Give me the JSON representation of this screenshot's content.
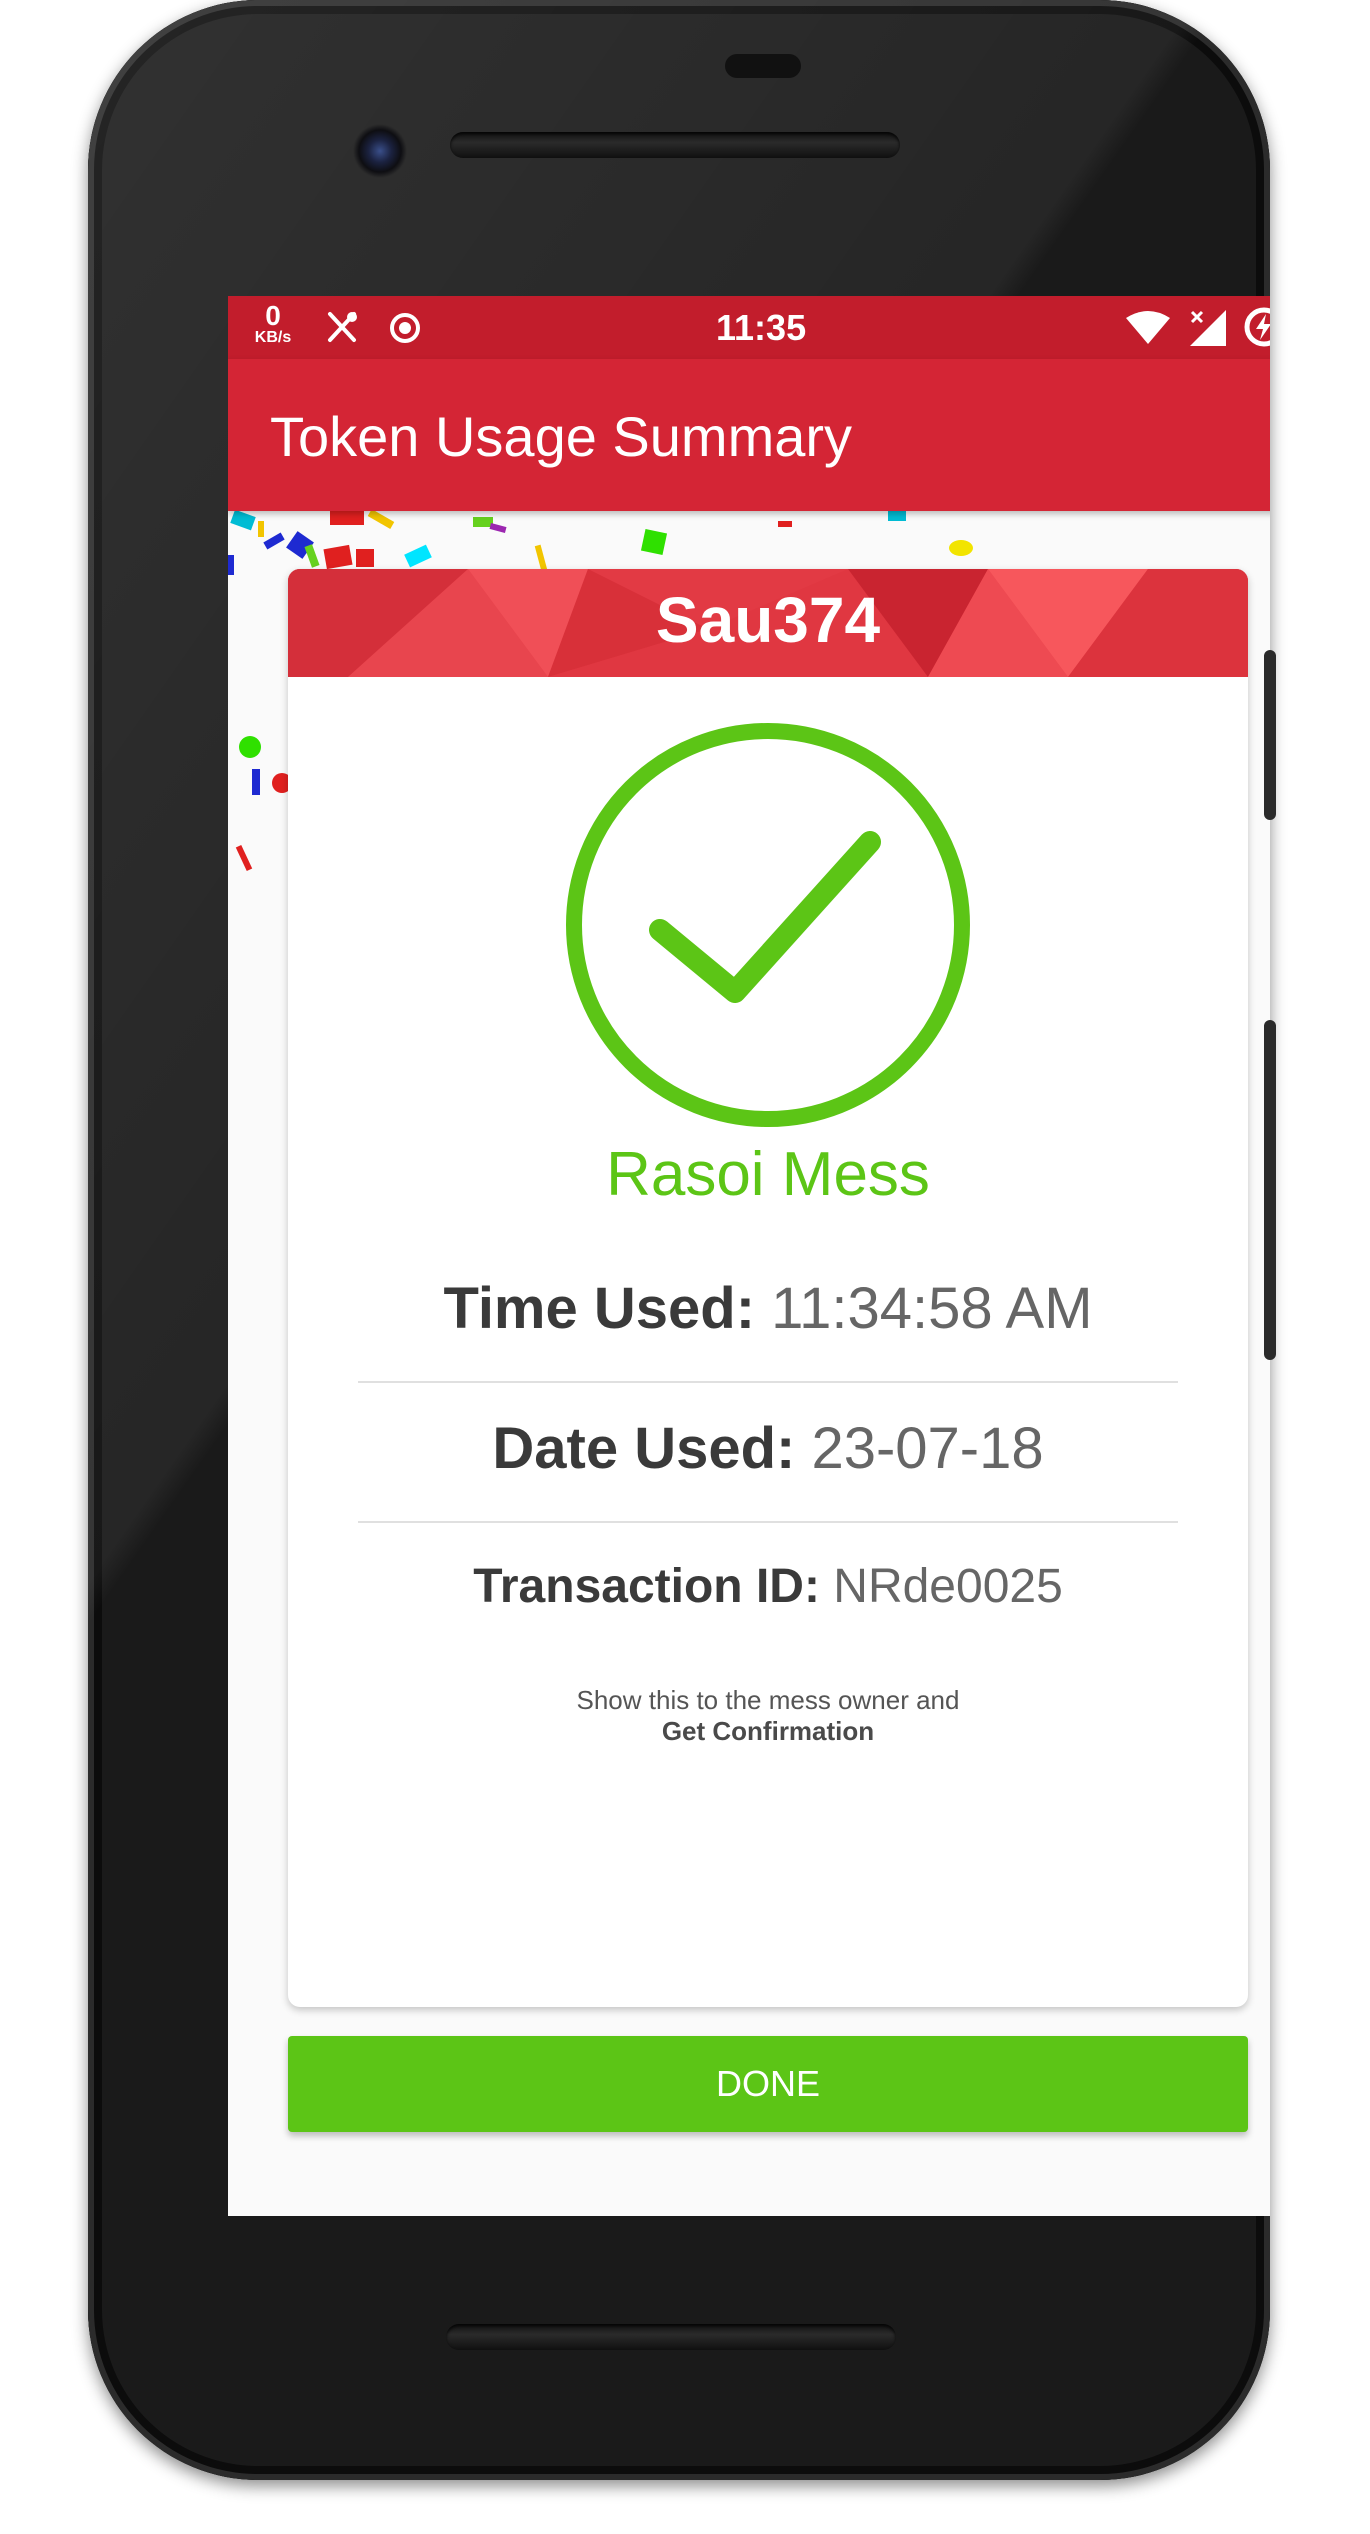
{
  "status_bar": {
    "net_speed_value": "0",
    "net_speed_unit": "KB/s",
    "time": "11:35",
    "left_icons": [
      "fork-knife-icon",
      "record-icon"
    ],
    "right_icons": [
      "wifi-icon",
      "cell-signal-icon",
      "battery-charging-icon"
    ]
  },
  "app_bar": {
    "title": "Token Usage Summary",
    "color": "#d42535"
  },
  "card": {
    "user_code": "Sau374",
    "status_icon": "check-circle-icon",
    "mess_name": "Rasoi Mess",
    "time_label": "Time Used:",
    "time_value": "11:34:58 AM",
    "date_label": "Date Used:",
    "date_value": "23-07-18",
    "txn_label": "Transaction ID:",
    "txn_value": "NRde0025",
    "hint_line1": "Show this to the mess owner and",
    "hint_line2": "Get Confirmation"
  },
  "done_button": {
    "label": "DONE",
    "color": "#5cc516"
  },
  "colors": {
    "accent_green": "#5cc516",
    "header_red": "#e23a44"
  }
}
